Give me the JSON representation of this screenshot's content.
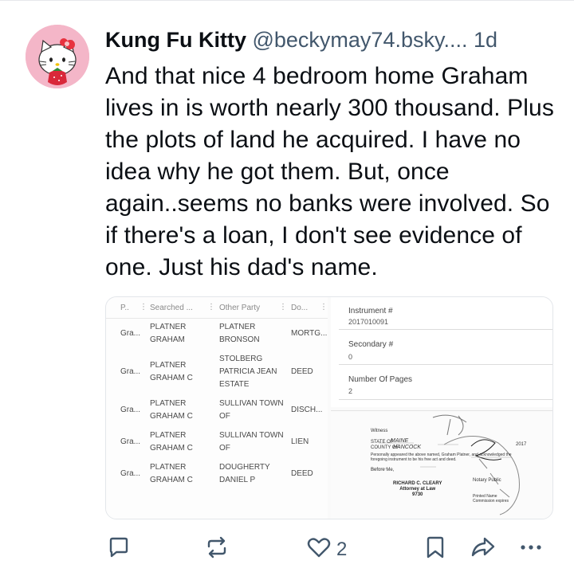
{
  "post": {
    "author_name": "Kung Fu Kitty",
    "handle": "@beckymay74.bsky....",
    "time": "1d",
    "text": "And that nice 4 bedroom home Graham lives in is worth nearly 300 thousand. Plus the plots of land he acquired. I have no idea why he got them. But, once again..seems no banks were involved. So if there's a loan, I don't see evidence of one. Just his dad's name."
  },
  "embed": {
    "table": {
      "headers": [
        "P..",
        "Searched ...",
        "Other Party",
        "Do..."
      ],
      "rows": [
        {
          "p": "Gra...",
          "searched": "PLATNER\nGRAHAM",
          "other": "PLATNER\nBRONSON",
          "doc": "MORTG..."
        },
        {
          "p": "Gra...",
          "searched": "PLATNER\nGRAHAM C",
          "other": "STOLBERG\nPATRICIA JEAN\nESTATE",
          "doc": "DEED"
        },
        {
          "p": "Gra...",
          "searched": "PLATNER\nGRAHAM C",
          "other": "SULLIVAN TOWN\nOF",
          "doc": "DISCH..."
        },
        {
          "p": "Gra...",
          "searched": "PLATNER\nGRAHAM C",
          "other": "SULLIVAN TOWN\nOF",
          "doc": "LIEN"
        },
        {
          "p": "Gra...",
          "searched": "PLATNER\nGRAHAM C",
          "other": "DOUGHERTY\nDANIEL P",
          "doc": "DEED"
        }
      ]
    },
    "instrument": {
      "instrument_label": "Instrument #",
      "instrument_value": "2017010091",
      "secondary_label": "Secondary #",
      "secondary_value": "0",
      "pages_label": "Number Of Pages",
      "pages_value": "2"
    },
    "notary": {
      "witness": "Witness",
      "state_of": "STATE OF",
      "state_hand": "MAINE",
      "county_of": "COUNTY OF",
      "county_hand": "HANCOCK",
      "year": "2017",
      "personally": "Personally appeared the above named, Graham Platner, and acknowledged the foregoing instrument to be his free act and deed.",
      "before_me": "Before Me,",
      "notary_name": "RICHARD C. CLEARY\nAttorney at Law\n9730",
      "notary_public": "Notary Public",
      "printed_name": "Printed Name",
      "commission": "Commission expires"
    }
  },
  "actions": {
    "like_count": "2"
  },
  "colors": {
    "text": "#0b0f14",
    "muted": "#42576c",
    "avatar_bg": "#f4b6c8",
    "bow": "#e8323f"
  }
}
